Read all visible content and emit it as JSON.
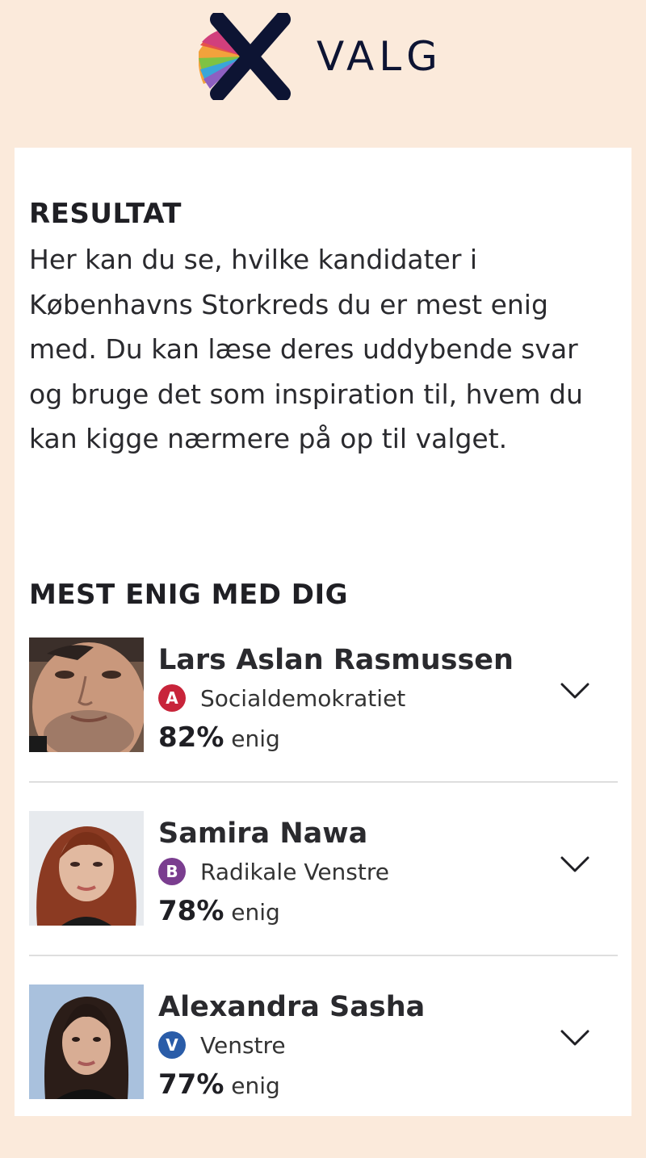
{
  "brand": {
    "name": "VALG"
  },
  "result": {
    "title": "RESULTAT",
    "intro": "Her kan du se, hvilke kandidater i Københavns Storkreds du er mest enig med. Du kan læse deres uddybende svar og bruge det som inspiration til, hvem du kan kigge nærmere på op til valget."
  },
  "match": {
    "title": "MEST ENIG MED DIG",
    "candidates": [
      {
        "name": "Lars Aslan Rasmussen",
        "party_letter": "A",
        "party": "Socialdemokratiet",
        "party_color": "#c8243a",
        "percent": "82%",
        "suffix": "enig",
        "expand_icon": "chevron-down-icon"
      },
      {
        "name": "Samira Nawa",
        "party_letter": "B",
        "party": "Radikale Venstre",
        "party_color": "#7a3d8f",
        "percent": "78%",
        "suffix": "enig",
        "expand_icon": "chevron-down-icon"
      },
      {
        "name": "Alexandra Sasha",
        "party_letter": "V",
        "party": "Venstre",
        "party_color": "#2a5ca8",
        "percent": "77%",
        "suffix": "enig",
        "expand_icon": "chevron-down-icon"
      }
    ]
  }
}
